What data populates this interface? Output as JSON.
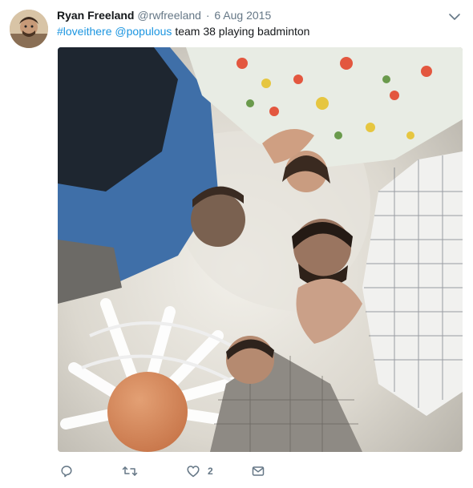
{
  "tweet": {
    "display_name": "Ryan Freeland",
    "handle": "@rwfreeland",
    "separator": "·",
    "date": "6 Aug 2015",
    "text": {
      "hashtag": "#loveithere",
      "mention": "@populous",
      "body": "team 38 playing badminton"
    },
    "actions": {
      "reply_icon": "reply-icon",
      "retweet_icon": "retweet-icon",
      "like_icon": "heart-icon",
      "like_count": "2",
      "message_icon": "envelope-icon"
    },
    "menu_icon": "chevron-down-icon",
    "colors": {
      "link": "#1b95e0",
      "secondary_text": "#657786",
      "primary_text": "#14171a"
    }
  }
}
